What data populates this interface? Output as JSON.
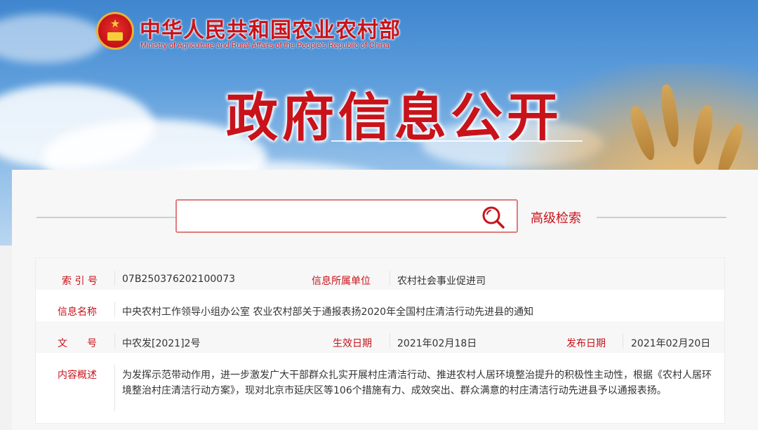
{
  "header": {
    "ministry_cn": "中华人民共和国农业农村部",
    "ministry_en": "Ministry of Agriculture and Rural Affairs of the People's Republic of China",
    "page_title": "政府信息公开"
  },
  "search": {
    "placeholder": "",
    "advanced_label": "高级检索"
  },
  "info": {
    "index_label": "索 引 号",
    "index_value": "07B250376202100073",
    "org_label": "信息所属单位",
    "org_value": "农村社会事业促进司",
    "name_label": "信息名称",
    "name_value": "中央农村工作领导小组办公室 农业农村部关于通报表扬2020年全国村庄清洁行动先进县的通知",
    "doc_label": "文　　号",
    "doc_value": "中农发[2021]2号",
    "effective_label": "生效日期",
    "effective_value": "2021年02月18日",
    "publish_label": "发布日期",
    "publish_value": "2021年02月20日",
    "summary_label": "内容概述",
    "summary_value": "为发挥示范带动作用，进一步激发广大干部群众扎实开展村庄清洁行动、推进农村人居环境整治提升的积极性主动性，根据《农村人居环境整治村庄清洁行动方案》，现对北京市延庆区等106个措施有力、成效突出、群众满意的村庄清洁行动先进县予以通报表扬。"
  },
  "colors": {
    "brand_red": "#c8131b",
    "search_border": "#e07c7c"
  }
}
